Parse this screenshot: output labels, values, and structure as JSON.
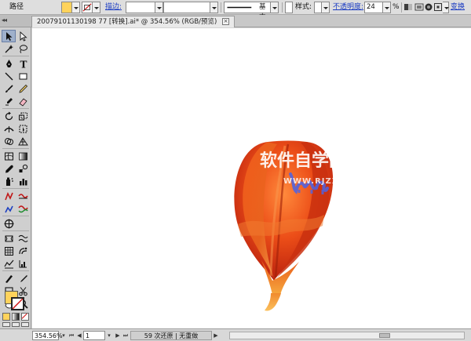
{
  "control_bar": {
    "path_label": "路径",
    "fill_color": "#ffd35c",
    "stroke_label": "描边:",
    "stroke_weight_value": "",
    "brush_value": "",
    "profile_label": "基本",
    "style_label": "样式:",
    "opacity_label": "不透明度:",
    "opacity_value": "24",
    "percent": "%",
    "transform_label": "变换"
  },
  "document": {
    "tab_title": "20079101130198 77 [转换].ai* @ 354.56% (RGB/预览)",
    "close_glyph": "×"
  },
  "tools_panel": {
    "grip": "◂◂",
    "fill_swatch_color": "#ffd35c",
    "icons": [
      "selection-tool",
      "direct-selection-tool",
      "magic-wand-tool",
      "lasso-tool",
      "pen-tool",
      "type-tool",
      "line-tool",
      "rectangle-tool",
      "paintbrush-tool",
      "pencil-tool",
      "blob-brush-tool",
      "eraser-tool",
      "rotate-tool",
      "scale-tool",
      "width-tool",
      "free-transform-tool",
      "shape-builder-tool",
      "perspective-grid-tool",
      "mesh-tool",
      "gradient-tool",
      "eyedropper-tool",
      "blend-tool",
      "symbol-sprayer-tool",
      "column-graph-tool",
      "symbol-extra-tool",
      "graph-extra-tool",
      "curve-tool",
      "curve-extra-tool",
      "target-tool",
      "artboard-tool",
      "slice-tool",
      "hand-tool",
      "zoom-tool"
    ]
  },
  "artwork": {
    "watermark_title": "软件自学网",
    "watermark_url": "WWW.RJZXW.COM"
  },
  "status_bar": {
    "zoom": "354.56%",
    "page": "1",
    "info": "59 次还原 | 无重做"
  }
}
